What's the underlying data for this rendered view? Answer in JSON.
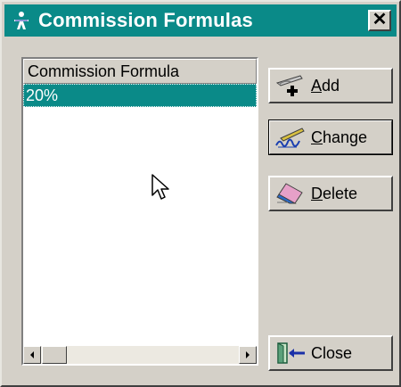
{
  "window": {
    "title": "Commission Formulas",
    "close_glyph": "✕",
    "colors": {
      "titlebar": "#0a8a88",
      "face": "#d4d0c8",
      "selection": "#0a8a88"
    }
  },
  "list": {
    "column_header": "Commission Formula",
    "rows": [
      "20%"
    ],
    "selected_index": 0
  },
  "buttons": {
    "add": {
      "mnemonic": "A",
      "rest": "dd",
      "icon": "pen-plus-icon"
    },
    "change": {
      "mnemonic": "C",
      "rest": "hange",
      "icon": "signature-pen-icon"
    },
    "delete": {
      "mnemonic": "D",
      "rest": "elete",
      "icon": "eraser-icon"
    },
    "close": {
      "label": "Close",
      "icon": "door-exit-icon"
    }
  }
}
